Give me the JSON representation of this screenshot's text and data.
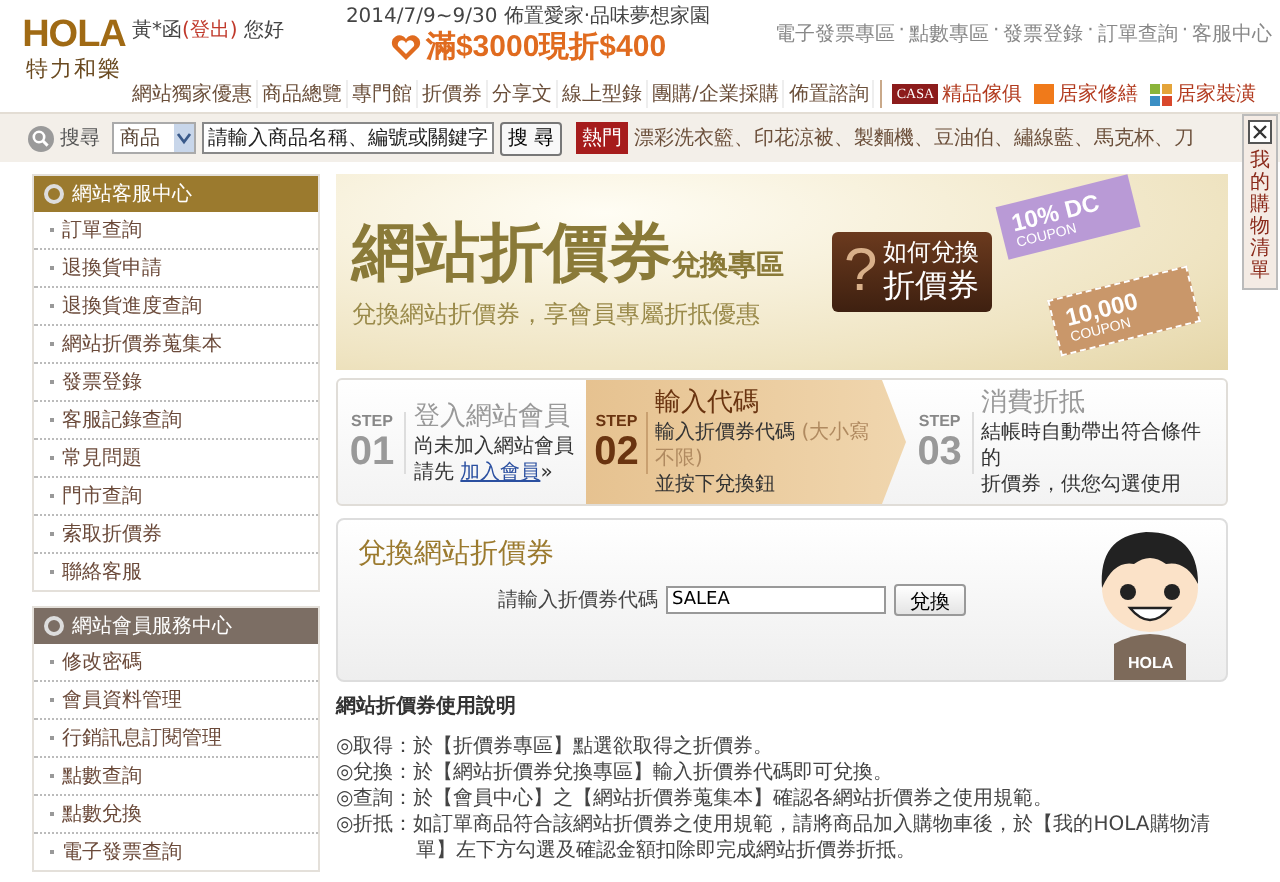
{
  "logo": {
    "brand": "HOLA",
    "name": "特力和樂"
  },
  "greeting": {
    "user": "黃*函",
    "logout": "(登出)",
    "suffix": "您好"
  },
  "promo": {
    "date_line": "2014/7/9~9/30 佈置愛家‧品味夢想家園",
    "offer": "滿$3000現折$400"
  },
  "top_links": {
    "separator": "·",
    "items": [
      "電子發票專區",
      "點數專區",
      "發票登錄",
      "訂單查詢",
      "客服中心"
    ]
  },
  "nav": [
    "網站獨家優惠",
    "商品總覽",
    "專門館",
    "折價券",
    "分享文",
    "線上型錄",
    "團購/企業採購",
    "佈置諮詢"
  ],
  "categories": [
    {
      "kind": "casa",
      "logo": "CASA",
      "label": "精品傢俱"
    },
    {
      "kind": "square",
      "label": "居家修繕"
    },
    {
      "kind": "blocks",
      "label": "居家裝潢"
    }
  ],
  "search": {
    "label": "搜尋",
    "scope": "商品",
    "value": "請輸入商品名稱、編號或關鍵字",
    "button": "搜 尋",
    "hot_tag": "熱門",
    "hot_separator": "、",
    "hot_items": [
      "漂彩洗衣籃",
      "印花涼被",
      "製麵機",
      "豆油伯",
      "繡線藍",
      "馬克杯",
      "刀"
    ]
  },
  "cart_tab": {
    "label": "我的購物清單"
  },
  "sidebar": [
    {
      "title": "網站客服中心",
      "active": true,
      "items": [
        "訂單查詢",
        "退換貨申請",
        "退換貨進度查詢",
        "網站折價券蒐集本",
        "發票登錄",
        "客服記錄查詢",
        "常見問題",
        "門市查詢",
        "索取折價券",
        "聯絡客服"
      ]
    },
    {
      "title": "網站會員服務中心",
      "active": false,
      "items": [
        "修改密碼",
        "會員資料管理",
        "行銷訊息訂閱管理",
        "點數查詢",
        "點數兌換",
        "電子發票查詢"
      ]
    }
  ],
  "banner": {
    "title": "網站折價券",
    "title_suffix": "兌換專區",
    "subtitle": "兌換網站折價券，享會員專屬折抵優惠",
    "howto": {
      "mark": "?",
      "line1": "如何兌換",
      "line2": "折價券"
    },
    "coupons": [
      {
        "value": "10% DC",
        "label": "COUPON"
      },
      {
        "value": "10,000",
        "label": "COUPON"
      }
    ]
  },
  "steps": [
    {
      "label": "STEP",
      "number": "01",
      "title": "登入網站會員",
      "active": false,
      "lines": [
        [
          {
            "kind": "text",
            "text": "尚未加入網站會員"
          }
        ],
        [
          {
            "kind": "text",
            "text": "請先 "
          },
          {
            "kind": "link",
            "text": "加入會員"
          },
          {
            "kind": "text",
            "text": "»"
          }
        ]
      ]
    },
    {
      "label": "STEP",
      "number": "02",
      "title": "輸入代碼",
      "active": true,
      "lines": [
        [
          {
            "kind": "text",
            "text": "輸入折價券代碼 "
          },
          {
            "kind": "note",
            "text": "(大小寫不限)"
          }
        ],
        [
          {
            "kind": "text",
            "text": "並按下兌換鈕"
          }
        ]
      ]
    },
    {
      "label": "STEP",
      "number": "03",
      "title": "消費折抵",
      "active": false,
      "lines": [
        [
          {
            "kind": "text",
            "text": "結帳時自動帶出符合條件的"
          }
        ],
        [
          {
            "kind": "text",
            "text": "折價券，供您勾選使用"
          }
        ]
      ]
    }
  ],
  "redeem": {
    "title": "兌換網站折價券",
    "label": "請輸入折價券代碼",
    "value": "SALEA",
    "button": "兌換",
    "mascot_logo": "HOLA"
  },
  "instructions": {
    "title": "網站折價券使用說明",
    "items": [
      {
        "label": "◎取得：",
        "text": "於【折價券專區】點選欲取得之折價券。"
      },
      {
        "label": "◎兌換：",
        "text": "於【網站折價券兌換專區】輸入折價券代碼即可兌換。"
      },
      {
        "label": "◎查詢：",
        "text": "於【會員中心】之【網站折價券蒐集本】確認各網站折價券之使用規範。"
      },
      {
        "label": "◎折抵：",
        "text": "如訂單商品符合該網站折價券之使用規範，請將商品加入購物車後，於【我的HOLA購物清單】左下方勾選及確認金額扣除即完成網站折價券折抵。"
      }
    ]
  }
}
